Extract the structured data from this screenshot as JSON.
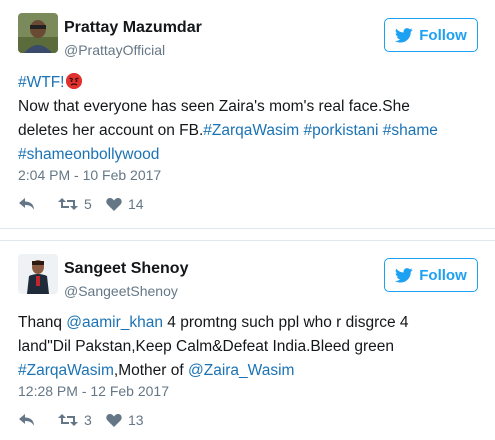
{
  "tweets": [
    {
      "name": "Prattay Mazumdar",
      "handle": "@PrattayOfficial",
      "follow_label": "Follow",
      "text_lines": [
        [
          {
            "t": "#WTF!",
            "link": true
          }
        ],
        [
          {
            "t": "Now that everyone has seen Zaira's mom's real face.She",
            "link": false
          }
        ],
        [
          {
            "t": "deletes her account on FB.",
            "link": false
          },
          {
            "t": "#ZarqaWasim",
            "link": true
          },
          {
            "t": " ",
            "link": false
          },
          {
            "t": "#porkistani",
            "link": true
          },
          {
            "t": " ",
            "link": false
          },
          {
            "t": "#shame",
            "link": true
          }
        ],
        [
          {
            "t": "#shameonbollywood",
            "link": true
          }
        ]
      ],
      "timestamp": "2:04 PM - 10 Feb 2017",
      "retweets": "5",
      "likes": "14"
    },
    {
      "name": "Sangeet Shenoy",
      "handle": "@SangeetShenoy",
      "follow_label": "Follow",
      "text_lines": [
        [
          {
            "t": "Thanq ",
            "link": false
          },
          {
            "t": "@aamir_khan",
            "link": true
          },
          {
            "t": " 4 promtng such ppl who r disgrce 4",
            "link": false
          }
        ],
        [
          {
            "t": "land\"Dil Pakstan,Keep Calm&Defeat India.Bleed green",
            "link": false
          }
        ],
        [
          {
            "t": "#ZarqaWasim",
            "link": true
          },
          {
            "t": ",Mother of ",
            "link": false
          },
          {
            "t": "@Zaira_Wasim",
            "link": true
          }
        ]
      ],
      "timestamp": "12:28 PM - 12 Feb 2017",
      "retweets": "3",
      "likes": "13"
    }
  ],
  "icons": {
    "reply": "reply-icon",
    "retweet": "retweet-icon",
    "like": "heart-icon",
    "bird": "twitter-bird-icon",
    "emoji": "angry-face-emoji"
  },
  "colors": {
    "link": "#1b73b5",
    "twitter_blue": "#1da1f2",
    "muted": "#657786"
  }
}
